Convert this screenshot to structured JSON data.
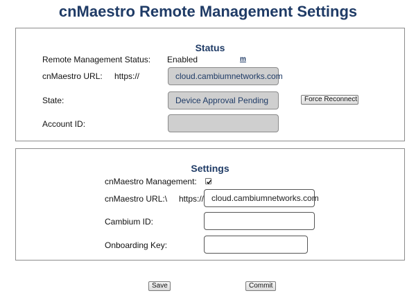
{
  "page": {
    "title": "cnMaestro Remote Management Settings"
  },
  "status": {
    "heading": "Status",
    "remote_mgmt_label": "Remote Management Status:",
    "remote_mgmt_value": "Enabled",
    "m_link": "m",
    "url_label": "cnMaestro URL:",
    "url_prefix": "https://",
    "url_value": "cloud.cambiumnetworks.com",
    "state_label": "State:",
    "state_value": "Device Approval Pending",
    "force_reconnect_label": "Force Reconnect",
    "account_id_label": "Account ID:",
    "account_id_value": ""
  },
  "settings": {
    "heading": "Settings",
    "management_label": "cnMaestro Management:",
    "management_checked": true,
    "url_label": "cnMaestro URL:\\",
    "url_prefix": "https://",
    "url_value": "cloud.cambiumnetworks.com",
    "cambium_id_label": "Cambium ID:",
    "cambium_id_value": "",
    "onboarding_key_label": "Onboarding Key:",
    "onboarding_key_value": ""
  },
  "actions": {
    "save_label": "Save",
    "commit_label": "Commit"
  }
}
